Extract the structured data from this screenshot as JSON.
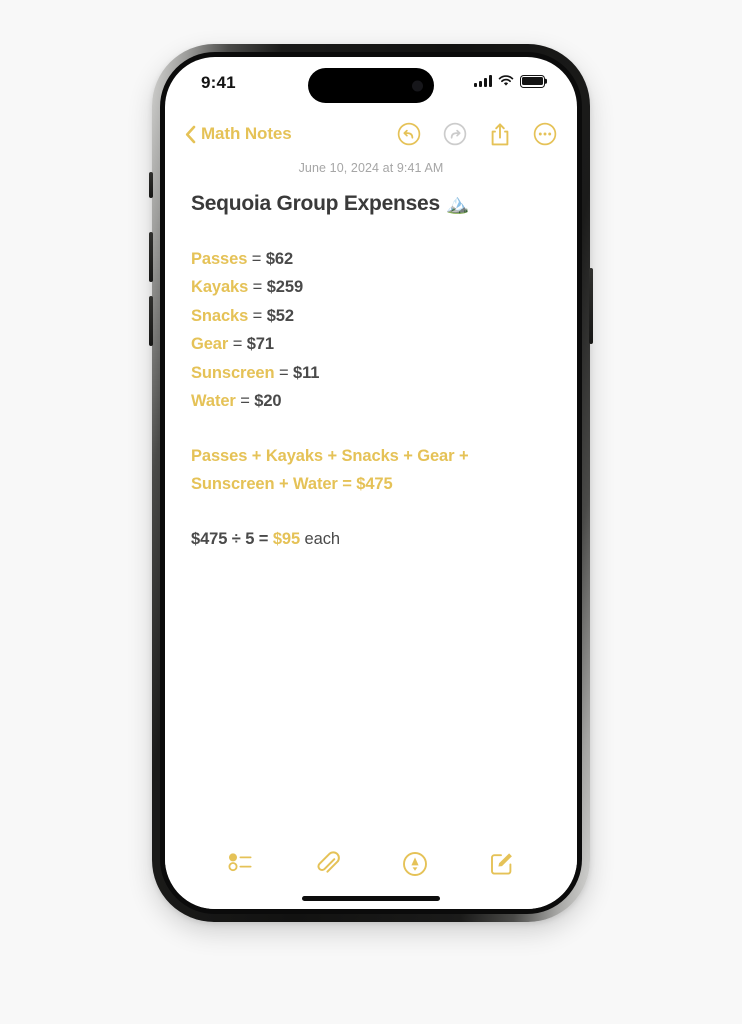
{
  "page": {
    "background_color": "#f8f8f8",
    "device": "iphone",
    "accent_color": "#e5c257",
    "text_color": "#4a4a4a"
  },
  "status_bar": {
    "time": "9:41",
    "signal_icon": "cellular-bars-icon",
    "wifi_icon": "wifi-icon",
    "battery_icon": "battery-full-icon"
  },
  "nav_bar": {
    "back_icon": "chevron-left-icon",
    "back_label": "Math Notes",
    "actions": [
      {
        "name": "undo-button",
        "icon": "undo-circle-icon",
        "enabled": true,
        "color": "#e5c257"
      },
      {
        "name": "redo-button",
        "icon": "redo-circle-icon",
        "enabled": false,
        "color": "#c9c9c9"
      },
      {
        "name": "share-button",
        "icon": "share-upload-icon",
        "enabled": true,
        "color": "#e5c257"
      },
      {
        "name": "more-button",
        "icon": "ellipsis-circle-icon",
        "enabled": true,
        "color": "#e5c257"
      }
    ]
  },
  "note": {
    "date": "June 10, 2024 at 9:41 AM",
    "title": "Sequoia Group Expenses",
    "title_emoji": "🏔️",
    "expenses": [
      {
        "label": "Passes",
        "equals": "=",
        "amount": "$62"
      },
      {
        "label": "Kayaks",
        "equals": "=",
        "amount": "$259"
      },
      {
        "label": "Snacks",
        "equals": "=",
        "amount": "$52"
      },
      {
        "label": "Gear",
        "equals": "=",
        "amount": "$71"
      },
      {
        "label": "Sunscreen",
        "equals": "=",
        "amount": "$11"
      },
      {
        "label": "Water",
        "equals": "=",
        "amount": "$20"
      }
    ],
    "sum_expression": {
      "line1_terms": [
        "Passes",
        "Kayaks",
        "Snacks",
        "Gear"
      ],
      "line2_terms": [
        "Sunscreen",
        "Water"
      ],
      "plus": "+",
      "equals": "=",
      "total": "$475"
    },
    "division_expression": {
      "dividend": "$475",
      "operator": "÷",
      "divisor": "5",
      "equals": "=",
      "result": "$95",
      "suffix": "each"
    }
  },
  "toolbar": {
    "items": [
      {
        "name": "checklist-button",
        "icon": "checklist-icon"
      },
      {
        "name": "attachment-button",
        "icon": "paperclip-icon"
      },
      {
        "name": "markup-button",
        "icon": "markup-pen-circle-icon"
      },
      {
        "name": "compose-button",
        "icon": "compose-pencil-square-icon"
      }
    ]
  }
}
